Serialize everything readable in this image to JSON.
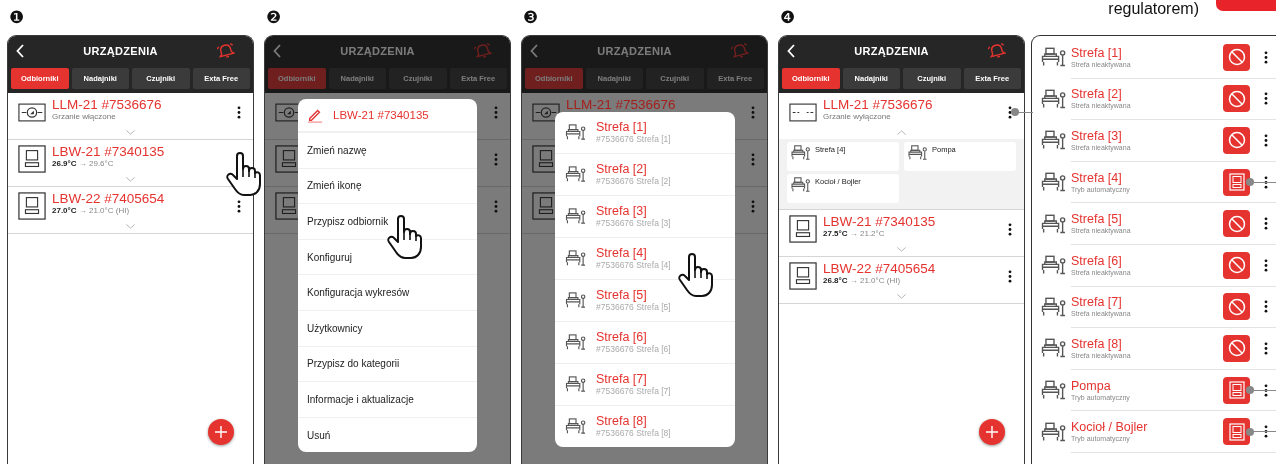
{
  "screens": [
    {
      "step": "❶",
      "title": "URZĄDZENIA",
      "tabs": [
        {
          "label": "Odbiorniki",
          "selected": true
        },
        {
          "label": "Nadajniki",
          "selected": false
        },
        {
          "label": "Czujniki",
          "selected": false
        },
        {
          "label": "Exta Free",
          "selected": false
        }
      ],
      "dimmed": false,
      "add_button": true,
      "devices": [
        {
          "kind": "module",
          "heating": true,
          "name": "LLM-21 #7536676",
          "status": "Grzanie włączone",
          "expanded": false,
          "tapped": false
        },
        {
          "kind": "thermostat",
          "name": "LBW-21 #7340135",
          "reading": "**26.9°C** → 29.6°C",
          "expanded": false,
          "tapped": true
        },
        {
          "kind": "thermostat",
          "name": "LBW-22 #7405654",
          "reading": "**27.0°C** → 21.0°C (HI)",
          "expanded": false,
          "tapped": false
        }
      ]
    },
    {
      "step": "❷",
      "title": "URZĄDZENIA",
      "tabs": [
        {
          "label": "Odbiorniki",
          "selected": true
        },
        {
          "label": "Nadajniki",
          "selected": false
        },
        {
          "label": "Czujniki",
          "selected": false
        },
        {
          "label": "Exta Free",
          "selected": false
        }
      ],
      "dimmed": true,
      "add_button": false,
      "devices": [
        {
          "kind": "module",
          "heating": true
        },
        {
          "kind": "thermostat"
        },
        {
          "kind": "thermostat"
        }
      ],
      "popup": {
        "kind": "menu",
        "title": "LBW-21 #7340135",
        "items": [
          {
            "label": "Zmień nazwę",
            "tapped": false
          },
          {
            "label": "Zmień ikonę",
            "tapped": false
          },
          {
            "label": "Przypisz odbiornik",
            "tapped": true
          },
          {
            "label": "Konfiguruj",
            "tapped": false
          },
          {
            "label": "Konfiguracja wykresów",
            "tapped": false
          },
          {
            "label": "Użytkownicy",
            "tapped": false
          },
          {
            "label": "Przypisz do kategorii",
            "tapped": false
          },
          {
            "label": "Informacje i aktualizacje",
            "tapped": false
          },
          {
            "label": "Usuń",
            "tapped": false
          }
        ]
      }
    },
    {
      "step": "❸",
      "title": "URZĄDZENIA",
      "tabs": [
        {
          "label": "Odbiorniki",
          "selected": true
        },
        {
          "label": "Nadajniki",
          "selected": false
        },
        {
          "label": "Czujniki",
          "selected": false
        },
        {
          "label": "Exta Free",
          "selected": false
        }
      ],
      "dimmed": true,
      "add_button": false,
      "devices": [
        {
          "kind": "module",
          "heating": true,
          "name": "LLM-21 #7536676"
        },
        {
          "kind": "thermostat"
        },
        {
          "kind": "thermostat"
        }
      ],
      "popup": {
        "kind": "zones",
        "items": [
          {
            "name": "Strefa [1]",
            "detail": "#7536676 Strefa [1]",
            "tapped": false
          },
          {
            "name": "Strefa [2]",
            "detail": "#7536676 Strefa [2]",
            "tapped": false
          },
          {
            "name": "Strefa [3]",
            "detail": "#7536676 Strefa [3]",
            "tapped": false
          },
          {
            "name": "Strefa [4]",
            "detail": "#7536676 Strefa [4]",
            "tapped": true
          },
          {
            "name": "Strefa [5]",
            "detail": "#7536676 Strefa [5]",
            "tapped": false
          },
          {
            "name": "Strefa [6]",
            "detail": "#7536676 Strefa [6]",
            "tapped": false
          },
          {
            "name": "Strefa [7]",
            "detail": "#7536676 Strefa [7]",
            "tapped": false
          },
          {
            "name": "Strefa [8]",
            "detail": "#7536676 Strefa [8]",
            "tapped": false
          }
        ]
      }
    },
    {
      "step": "❹",
      "title": "URZĄDZENIA",
      "tabs": [
        {
          "label": "Odbiorniki",
          "selected": true
        },
        {
          "label": "Nadajniki",
          "selected": false
        },
        {
          "label": "Czujniki",
          "selected": false
        },
        {
          "label": "Exta Free",
          "selected": false
        }
      ],
      "dimmed": false,
      "add_button": true,
      "devices": [
        {
          "kind": "module",
          "heating": false,
          "name": "LLM-21 #7536676",
          "status": "Grzanie wyłączone",
          "expanded": true,
          "zones": [
            "Strefa [4]",
            "Pompa",
            "Kocioł / Bojler"
          ],
          "callout": true
        },
        {
          "kind": "thermostat",
          "name": "LBW-21 #7340135",
          "reading": "**27.5°C** → 21.2°C",
          "expanded": false,
          "callout": false
        },
        {
          "kind": "thermostat",
          "name": "LBW-22 #7405654",
          "reading": "**26.8°C** → 21.0°C (HI)",
          "expanded": false,
          "callout": false
        }
      ]
    }
  ],
  "panel": {
    "caption": "regulatorem)",
    "rows": [
      {
        "name": "Strefa [1]",
        "status": "Strefa nieaktywana",
        "kind": "inactive",
        "callout": false
      },
      {
        "name": "Strefa [2]",
        "status": "Strefa nieaktywana",
        "kind": "inactive",
        "callout": false
      },
      {
        "name": "Strefa [3]",
        "status": "Strefa nieaktywana",
        "kind": "inactive",
        "callout": false
      },
      {
        "name": "Strefa [4]",
        "status": "Tryb automatyczny",
        "kind": "auto",
        "callout": true
      },
      {
        "name": "Strefa [5]",
        "status": "Strefa nieaktywana",
        "kind": "inactive",
        "callout": false
      },
      {
        "name": "Strefa [6]",
        "status": "Strefa nieaktywana",
        "kind": "inactive",
        "callout": false
      },
      {
        "name": "Strefa [7]",
        "status": "Strefa nieaktywana",
        "kind": "inactive",
        "callout": false
      },
      {
        "name": "Strefa [8]",
        "status": "Strefa nieaktywana",
        "kind": "inactive",
        "callout": false
      },
      {
        "name": "Pompa",
        "status": "Tryb automatyczny",
        "kind": "auto",
        "callout": true
      },
      {
        "name": "Kocioł / Bojler",
        "status": "Tryb automatyczny",
        "kind": "auto",
        "callout": true
      }
    ]
  }
}
